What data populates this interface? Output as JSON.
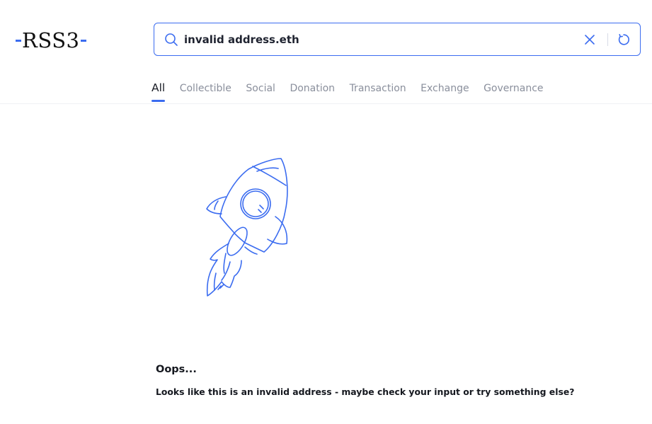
{
  "logo": {
    "text": "RSS3"
  },
  "search": {
    "value": "invalid address.eth",
    "accent_color": "#3b6cf0"
  },
  "icons": {
    "search": "search-icon",
    "clear": "close-icon",
    "refresh": "refresh-icon",
    "illustration": "rocket-icon"
  },
  "tabs": [
    {
      "label": "All",
      "active": true
    },
    {
      "label": "Collectible",
      "active": false
    },
    {
      "label": "Social",
      "active": false
    },
    {
      "label": "Donation",
      "active": false
    },
    {
      "label": "Transaction",
      "active": false
    },
    {
      "label": "Exchange",
      "active": false
    },
    {
      "label": "Governance",
      "active": false
    }
  ],
  "error": {
    "title": "Oops...",
    "message": "Looks like this is an invalid address - maybe check your input or try something else?"
  }
}
